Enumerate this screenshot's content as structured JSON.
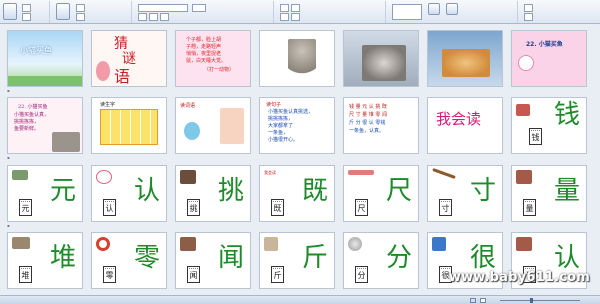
{
  "watermark": "www.baby611.com",
  "row1": {
    "s1_title": "小猫买鱼",
    "s2_title_a": "猜",
    "s2_title_b": "谜",
    "s2_title_c": "语",
    "s3_lines": [
      "个子都，脸上胡",
      "子翘，走路轻声",
      "悄悄，夜里捉老",
      "鼠，白天睡大觉。",
      "（打一动物）"
    ],
    "s7_title": "22. 小猫买鱼"
  },
  "row2": {
    "s8_lines": [
      "22. 小猫买鱼",
      "小猫买鱼认真，",
      "挑挑拣拣，",
      "鱼要新鲜。"
    ],
    "s9_label": "读生字",
    "s10_label": "读词语",
    "s11_label": "读句子",
    "s11_lines": [
      "小猫买鱼认真挑选，",
      "挑挑拣拣，",
      "大家都拿了",
      "一条鱼，",
      "小猫很开心。"
    ],
    "s12_lines": [
      "钱 量 元 认 挑 既",
      "尺 寸 量 堆 零 闻",
      "斤 分 很 认 零钱",
      "一条鱼，认真。"
    ],
    "s13_title": "我会读",
    "s14_char": "钱",
    "s14_card": "钱"
  },
  "row3": [
    {
      "char": "元",
      "card": "元"
    },
    {
      "char": "认",
      "card": "认"
    },
    {
      "char": "挑",
      "card": "挑"
    },
    {
      "char": "既",
      "card": "既",
      "label": "我会读"
    },
    {
      "char": "尺",
      "card": "尺"
    },
    {
      "char": "寸",
      "card": "寸"
    },
    {
      "char": "量",
      "card": "量"
    }
  ],
  "row4": [
    {
      "char": "堆",
      "card": "堆"
    },
    {
      "char": "零",
      "card": "零"
    },
    {
      "char": "闻",
      "card": "闻"
    },
    {
      "char": "斤",
      "card": "斤"
    },
    {
      "char": "分",
      "card": "分"
    },
    {
      "char": "很",
      "card": "很"
    },
    {
      "char": "认",
      "card": "认"
    }
  ]
}
